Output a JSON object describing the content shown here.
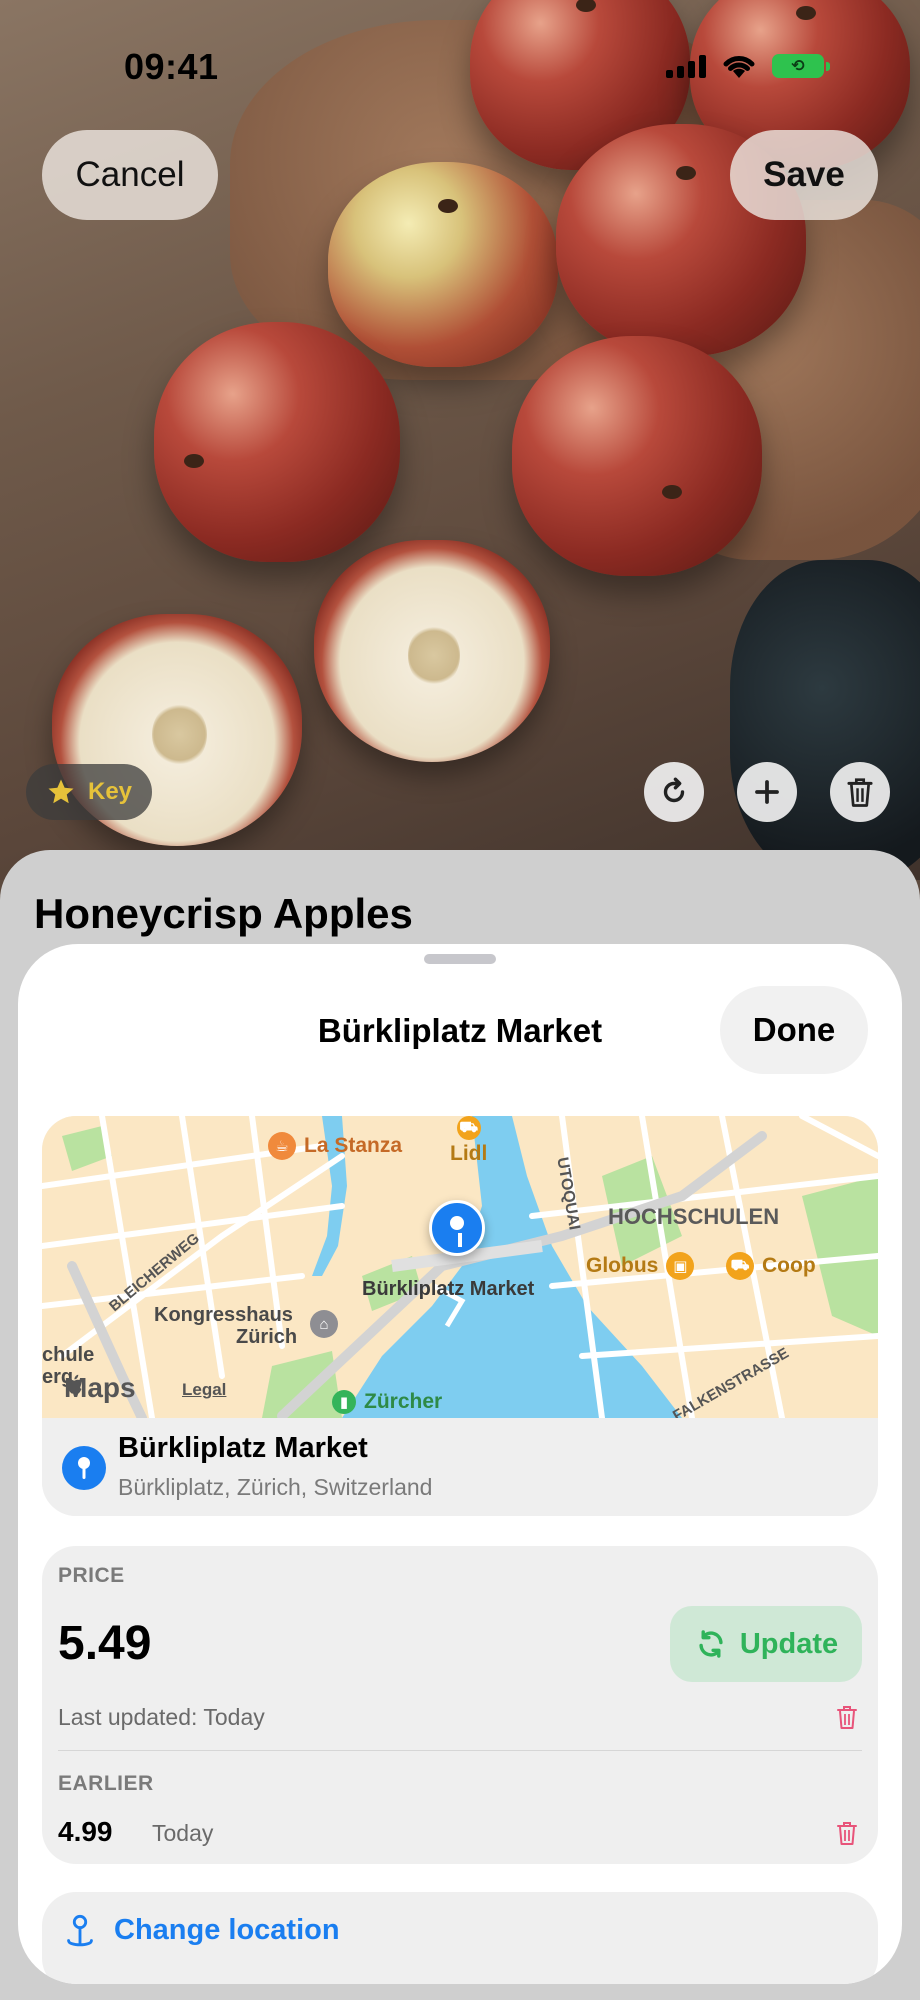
{
  "status": {
    "time": "09:41"
  },
  "toolbar": {
    "cancel_label": "Cancel",
    "save_label": "Save"
  },
  "photo": {
    "key_label": "Key"
  },
  "item": {
    "title": "Honeycrisp Apples"
  },
  "sheet": {
    "title": "Bürkliplatz Market",
    "done_label": "Done"
  },
  "map": {
    "labels": {
      "la_stanza": "La Stanza",
      "lidl": "Lidl",
      "utoquai": "UTOQUAI",
      "hochschulen": "HOCHSCHULEN",
      "bleicherweg": "BLEICHERWEG",
      "globus": "Globus",
      "coop": "Coop",
      "pin_label": "Bürkliplatz Market",
      "kongresshaus_1": "Kongresshaus",
      "kongresshaus_2": "Zürich",
      "chule": "chule",
      "erg": "erg",
      "zurcher": "Zürcher",
      "falkenstrasse": "FALKENSTRASSE"
    },
    "maps_label": "Maps",
    "legal_label": "Legal"
  },
  "location": {
    "name": "Bürkliplatz Market",
    "address": "Bürkliplatz, Zürich, Switzerland"
  },
  "price": {
    "section_label": "PRICE",
    "value": "5.49",
    "update_label": "Update",
    "last_updated": "Last updated: Today",
    "earlier_label": "EARLIER",
    "earlier_value": "4.99",
    "earlier_date": "Today"
  },
  "actions": {
    "change_location_label": "Change location"
  },
  "colors": {
    "accent_blue": "#1a7ef0",
    "update_green": "#2fb35a",
    "delete_red": "#e8547a",
    "key_gold": "#e6c23a"
  }
}
